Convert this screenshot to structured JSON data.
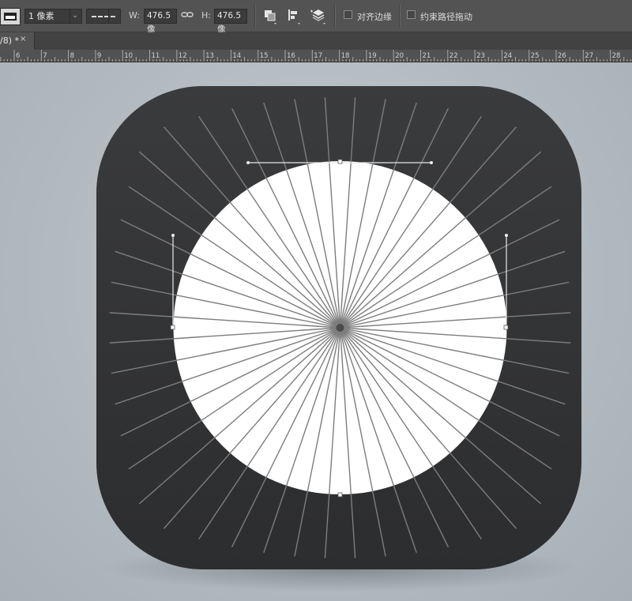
{
  "options_bar": {
    "stroke_width": "1 像素",
    "width_label": "W:",
    "width_value": "476.5 像",
    "height_label": "H:",
    "height_value": "476.5 像",
    "align_edges_label": "对齐边缘",
    "constrain_path_label": "约束路径拖动"
  },
  "document_tab": {
    "title": "/8) *",
    "close": "×"
  },
  "ruler": {
    "ticks": [
      "6",
      "7",
      "8",
      "9",
      "10",
      "11",
      "12",
      "13",
      "14",
      "15",
      "16",
      "17",
      "18",
      "19",
      "20",
      "21",
      "22",
      "23",
      "24",
      "25",
      "26",
      "27",
      "28"
    ]
  },
  "artwork": {
    "icon_background_color": "#333436",
    "circle_color": "#ffffff",
    "ray_color": "#7d7d7d",
    "ray_count": 48
  }
}
